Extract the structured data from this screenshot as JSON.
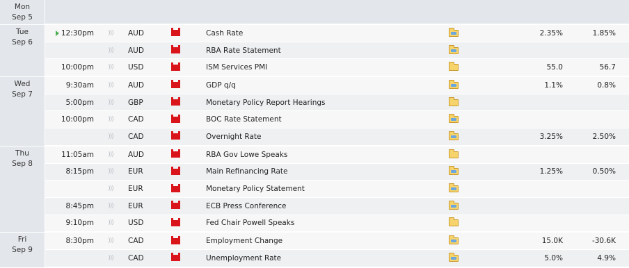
{
  "days": [
    {
      "weekday": "Mon",
      "date": "Sep 5",
      "events": []
    },
    {
      "weekday": "Tue",
      "date": "Sep 6",
      "events": [
        {
          "time": "12:30pm",
          "live": true,
          "currency": "AUD",
          "event": "Cash Rate",
          "forecast": "2.35%",
          "previous": "1.85%",
          "folder": "blue"
        },
        {
          "time": "",
          "live": false,
          "currency": "AUD",
          "event": "RBA Rate Statement",
          "forecast": "",
          "previous": "",
          "folder": "blue"
        },
        {
          "time": "10:00pm",
          "live": false,
          "currency": "USD",
          "event": "ISM Services PMI",
          "forecast": "55.0",
          "previous": "56.7",
          "folder": "plain"
        }
      ]
    },
    {
      "weekday": "Wed",
      "date": "Sep 7",
      "events": [
        {
          "time": "9:30am",
          "live": false,
          "currency": "AUD",
          "event": "GDP q/q",
          "forecast": "1.1%",
          "previous": "0.8%",
          "folder": "blue"
        },
        {
          "time": "5:00pm",
          "live": false,
          "currency": "GBP",
          "event": "Monetary Policy Report Hearings",
          "forecast": "",
          "previous": "",
          "folder": "plain"
        },
        {
          "time": "10:00pm",
          "live": false,
          "currency": "CAD",
          "event": "BOC Rate Statement",
          "forecast": "",
          "previous": "",
          "folder": "blue"
        },
        {
          "time": "",
          "live": false,
          "currency": "CAD",
          "event": "Overnight Rate",
          "forecast": "3.25%",
          "previous": "2.50%",
          "folder": "blue"
        }
      ]
    },
    {
      "weekday": "Thu",
      "date": "Sep 8",
      "events": [
        {
          "time": "11:05am",
          "live": false,
          "currency": "AUD",
          "event": "RBA Gov Lowe Speaks",
          "forecast": "",
          "previous": "",
          "folder": "plain"
        },
        {
          "time": "8:15pm",
          "live": false,
          "currency": "EUR",
          "event": "Main Refinancing Rate",
          "forecast": "1.25%",
          "previous": "0.50%",
          "folder": "blue"
        },
        {
          "time": "",
          "live": false,
          "currency": "EUR",
          "event": "Monetary Policy Statement",
          "forecast": "",
          "previous": "",
          "folder": "blue"
        },
        {
          "time": "8:45pm",
          "live": false,
          "currency": "EUR",
          "event": "ECB Press Conference",
          "forecast": "",
          "previous": "",
          "folder": "blue"
        },
        {
          "time": "9:10pm",
          "live": false,
          "currency": "USD",
          "event": "Fed Chair Powell Speaks",
          "forecast": "",
          "previous": "",
          "folder": "plain"
        }
      ]
    },
    {
      "weekday": "Fri",
      "date": "Sep 9",
      "events": [
        {
          "time": "8:30pm",
          "live": false,
          "currency": "CAD",
          "event": "Employment Change",
          "forecast": "15.0K",
          "previous": "-30.6K",
          "folder": "blue"
        },
        {
          "time": "",
          "live": false,
          "currency": "CAD",
          "event": "Unemployment Rate",
          "forecast": "5.0%",
          "previous": "4.9%",
          "folder": "blue"
        }
      ]
    }
  ],
  "icons": {
    "impact": "high-impact-flag-icon",
    "sound": "sound-icon",
    "detail": "folder-icon",
    "live": "play-icon"
  },
  "colors": {
    "impact_high": "#d9141a",
    "row_bg": "#f7f7f7",
    "row_alt_bg": "#eef0f2",
    "date_bg": "#e3e6ea"
  }
}
